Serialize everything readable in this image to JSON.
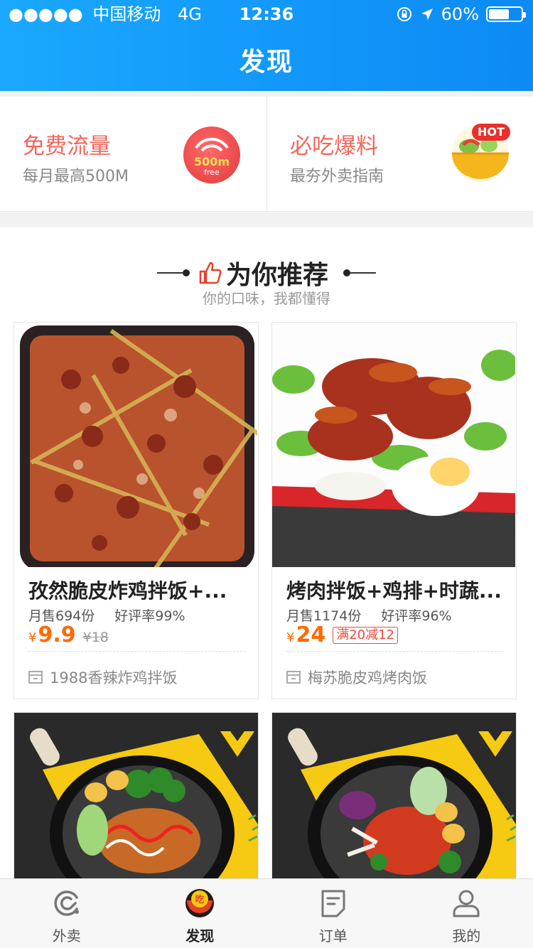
{
  "status": {
    "signal": "●●●●●",
    "carrier": "中国移动",
    "network": "4G",
    "time": "12:36",
    "battery": "60%"
  },
  "header": {
    "title": "发现"
  },
  "promos": [
    {
      "title": "免费流量",
      "subtitle": "每月最高500M",
      "badge_main": "500m",
      "badge_sub": "free"
    },
    {
      "title": "必吃爆料",
      "subtitle": "最夯外卖指南",
      "badge_main": "HOT"
    }
  ],
  "recommend": {
    "title": "为你推荐",
    "subtitle": "你的口味，我都懂得"
  },
  "cards": [
    {
      "name": "孜然脆皮炸鸡拌饭+...",
      "monthly_sales": "月售694份",
      "rating": "好评率99%",
      "currency": "¥",
      "price": "9.9",
      "old_price": "¥18",
      "shop": "1988香辣炸鸡拌饭"
    },
    {
      "name": "烤肉拌饭+鸡排+时蔬...",
      "monthly_sales": "月售1174份",
      "rating": "好评率96%",
      "currency": "¥",
      "price": "24",
      "promo": "满20减12",
      "shop": "梅苏脆皮鸡烤肉饭"
    }
  ],
  "tabs": [
    {
      "label": "外卖",
      "icon": "eleme-icon"
    },
    {
      "label": "发现",
      "icon": "discover-icon"
    },
    {
      "label": "订单",
      "icon": "order-icon"
    },
    {
      "label": "我的",
      "icon": "profile-icon"
    }
  ],
  "colors": {
    "header": "#1aa8ff",
    "accent_red": "#f4665b",
    "price_orange": "#ff6a00"
  }
}
